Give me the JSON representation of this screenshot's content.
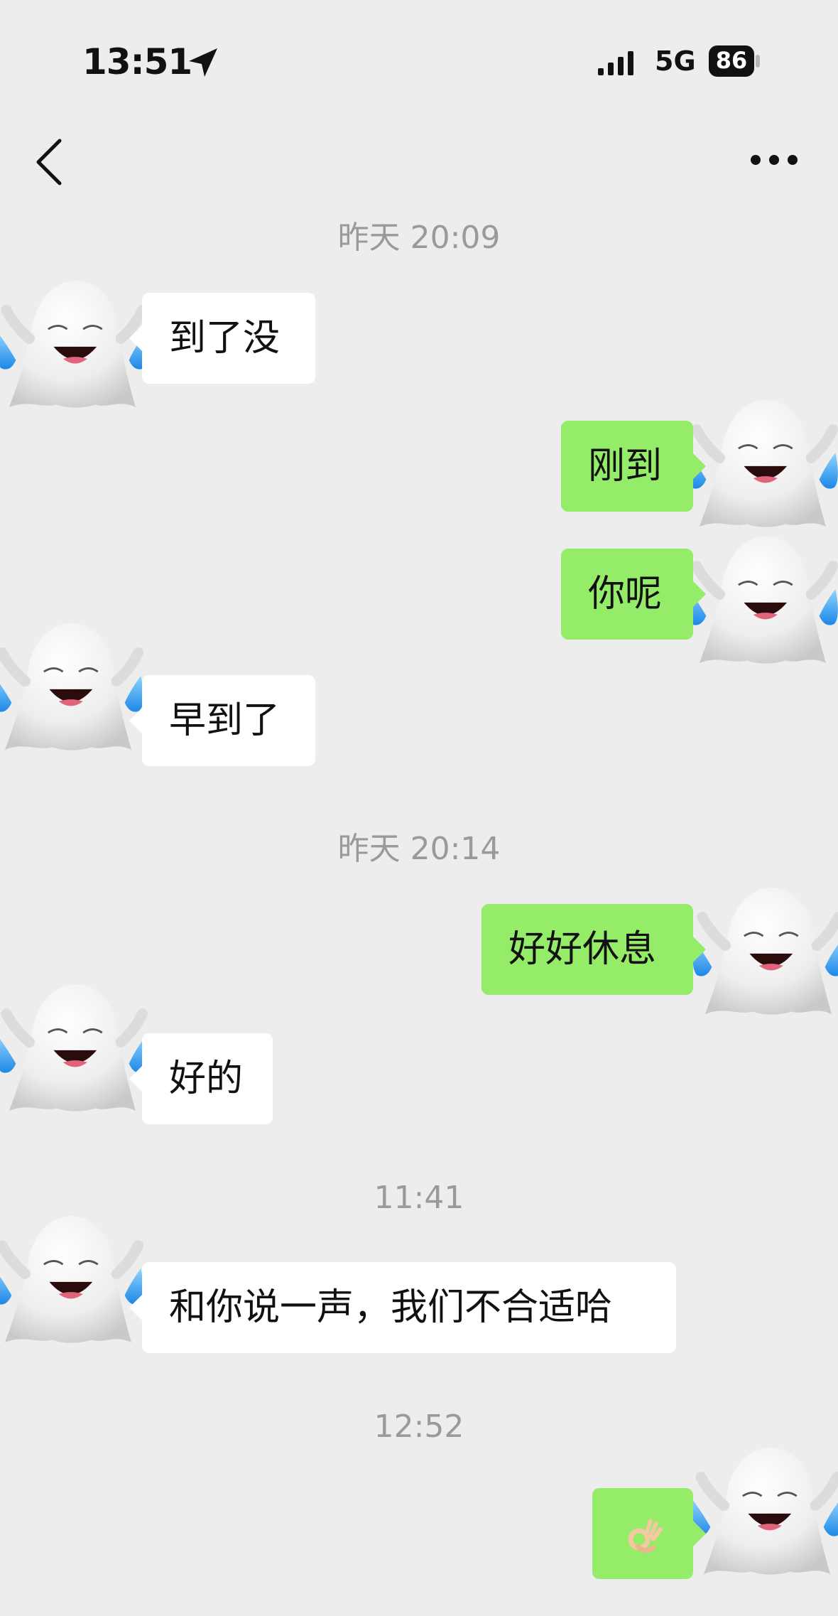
{
  "status_bar": {
    "time": "13:51",
    "location_icon": "location-arrow-icon",
    "signal_icon": "cellular-signal-icon",
    "network": "5G",
    "battery": "86"
  },
  "header": {
    "back_icon": "chevron-left-icon",
    "more_icon": "more-dots-icon"
  },
  "timestamps": [
    "昨天 20:09",
    "昨天 20:14",
    "11:41",
    "12:52"
  ],
  "messages": [
    {
      "side": "in",
      "text": "到了没"
    },
    {
      "side": "out",
      "text": "刚到"
    },
    {
      "side": "out",
      "text": "你呢"
    },
    {
      "side": "in",
      "text": "早到了"
    },
    {
      "side": "out",
      "text": "好好休息"
    },
    {
      "side": "in",
      "text": "好的"
    },
    {
      "side": "in",
      "text": "和你说一声，我们不合适哈"
    },
    {
      "side": "out",
      "text": "",
      "emoji": "ok-hand-icon"
    }
  ],
  "colors": {
    "background": "#ededed",
    "incoming_bubble": "#ffffff",
    "outgoing_bubble": "#95ec69",
    "timestamp_text": "#9a9a9a"
  },
  "avatar_icon": "laughing-ghost-avatar-icon"
}
